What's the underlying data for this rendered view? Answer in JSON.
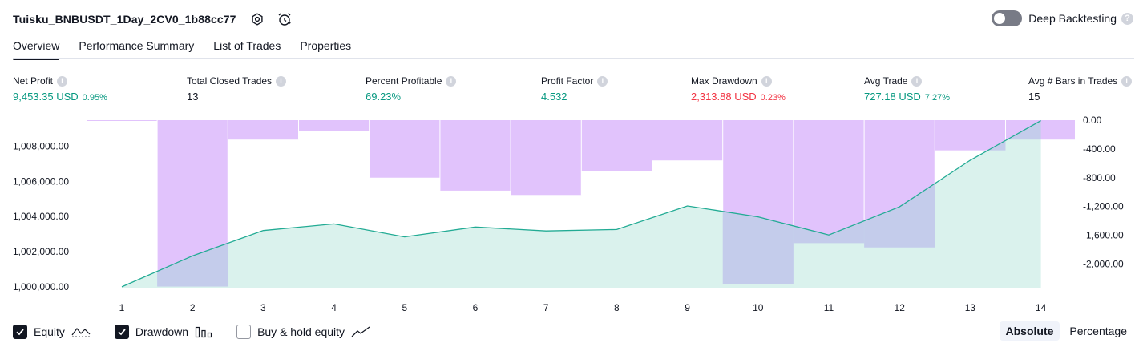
{
  "strategy_title": "Tuisku_BNBUSDT_1Day_2CV0_1b88cc77",
  "header_icons": [
    "settings-icon",
    "alarm-icon"
  ],
  "deep_backtesting": {
    "label": "Deep Backtesting",
    "enabled": false,
    "help": "?"
  },
  "tabs": [
    {
      "label": "Overview",
      "active": true
    },
    {
      "label": "Performance Summary",
      "active": false
    },
    {
      "label": "List of Trades",
      "active": false
    },
    {
      "label": "Properties",
      "active": false
    }
  ],
  "metrics": {
    "net_profit": {
      "label": "Net Profit",
      "value": "9,453.35 USD",
      "sub": "0.95%"
    },
    "total_closed_trades": {
      "label": "Total Closed Trades",
      "value": "13"
    },
    "percent_profitable": {
      "label": "Percent Profitable",
      "value": "69.23%"
    },
    "profit_factor": {
      "label": "Profit Factor",
      "value": "4.532"
    },
    "max_drawdown": {
      "label": "Max Drawdown",
      "value": "2,313.88 USD",
      "sub": "0.23%"
    },
    "avg_trade": {
      "label": "Avg Trade",
      "value": "727.18 USD",
      "sub": "7.27%"
    },
    "avg_bars": {
      "label": "Avg # Bars in Trades",
      "value": "15"
    }
  },
  "colors": {
    "green": "#089981",
    "red": "#f23645",
    "equity_line": "#22ab94",
    "equity_fill": "#d8f1ec",
    "drawdown_bar": "#e1c3fc"
  },
  "chart_data": {
    "type": "line",
    "x": [
      1,
      2,
      3,
      4,
      5,
      6,
      7,
      8,
      9,
      10,
      11,
      12,
      13,
      14
    ],
    "x_ticks": [
      "1",
      "2",
      "3",
      "4",
      "5",
      "6",
      "7",
      "8",
      "9",
      "10",
      "11",
      "12",
      "13",
      "14"
    ],
    "left_axis": {
      "ticks": [
        "1,000,000.00",
        "1,002,000.00",
        "1,004,000.00",
        "1,006,000.00",
        "1,008,000.00"
      ],
      "tick_values": [
        1000000,
        1002000,
        1004000,
        1006000,
        1008000
      ],
      "ylim": [
        999950,
        1009480
      ]
    },
    "right_axis": {
      "ticks": [
        "0.00",
        "-400.00",
        "-800.00",
        "-1,200.00",
        "-1,600.00",
        "-2,000.00"
      ],
      "tick_values": [
        0,
        -400,
        -800,
        -1200,
        -1600,
        -2000
      ],
      "ylim": [
        -2330,
        0
      ]
    },
    "series": [
      {
        "name": "Equity",
        "kind": "area",
        "axis": "left",
        "values": [
          1000000,
          1001760,
          1003200,
          1003580,
          1002840,
          1003400,
          1003180,
          1003260,
          1004600,
          1003980,
          1002950,
          1004550,
          1007200,
          1009453
        ]
      },
      {
        "name": "Drawdown",
        "kind": "bar",
        "axis": "right",
        "values": [
          -10,
          -2313.88,
          -270,
          -150,
          -800,
          -980,
          -1040,
          -710,
          -560,
          -2280,
          -1710,
          -1770,
          -420,
          -270
        ]
      }
    ]
  },
  "legend": {
    "equity": {
      "label": "Equity",
      "checked": true
    },
    "drawdown": {
      "label": "Drawdown",
      "checked": true
    },
    "buy_hold": {
      "label": "Buy & hold equity",
      "checked": false
    }
  },
  "view_modes": [
    {
      "label": "Absolute",
      "active": true
    },
    {
      "label": "Percentage",
      "active": false
    }
  ]
}
